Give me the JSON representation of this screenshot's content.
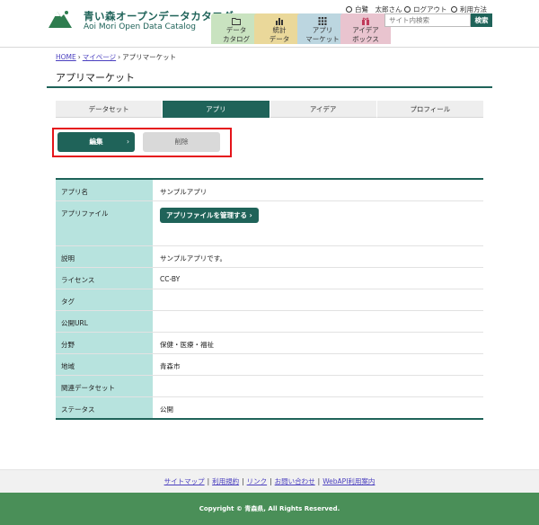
{
  "site": {
    "title": "青い森オープンデータカタログ",
    "subtitle": "Aoi Mori Open Data Catalog"
  },
  "nav": [
    {
      "line1": "データ",
      "line2": "カタログ",
      "icon": "folder-icon",
      "color": "#c9e3c0"
    },
    {
      "line1": "統計",
      "line2": "データ",
      "icon": "bar-chart-icon",
      "color": "#ead89a"
    },
    {
      "line1": "アプリ",
      "line2": "マーケット",
      "icon": "grid-icon",
      "color": "#bcd6e0"
    },
    {
      "line1": "アイデア",
      "line2": "ボックス",
      "icon": "gift-icon",
      "color": "#e9c4cf"
    }
  ],
  "utility": {
    "user": "白鷺　太郎さん",
    "logout": "ログアウト",
    "help": "利用方法"
  },
  "search": {
    "placeholder": "サイト内検索",
    "button": "検索"
  },
  "breadcrumb": {
    "home": "HOME",
    "mypage": "マイページ",
    "current": "アプリマーケット",
    "separator": "›"
  },
  "page_title": "アプリマーケット",
  "tabs": [
    {
      "label": "データセット",
      "active": false
    },
    {
      "label": "アプリ",
      "active": true
    },
    {
      "label": "アイデア",
      "active": false
    },
    {
      "label": "プロフィール",
      "active": false
    }
  ],
  "actions": {
    "edit": "編集",
    "edit_chevron": "›",
    "delete": "削除"
  },
  "detail": {
    "app_name": {
      "label": "アプリ名",
      "value": "サンプルアプリ"
    },
    "app_file": {
      "label": "アプリファイル",
      "button": "アプリファイルを管理する ›"
    },
    "description": {
      "label": "説明",
      "value": "サンプルアプリです。"
    },
    "license": {
      "label": "ライセンス",
      "value": "CC-BY"
    },
    "tags": {
      "label": "タグ",
      "value": ""
    },
    "public_url": {
      "label": "公開URL",
      "value": ""
    },
    "field": {
      "label": "分野",
      "value": "保健・医療・福祉"
    },
    "area": {
      "label": "地域",
      "value": "青森市"
    },
    "related": {
      "label": "関連データセット",
      "value": ""
    },
    "status": {
      "label": "ステータス",
      "value": "公開"
    }
  },
  "footer": {
    "links": [
      "サイトマップ",
      "利用規約",
      "リンク",
      "お問い合わせ",
      "WebAPI利用案内"
    ],
    "separator": "|",
    "copyright": "Copyright © 青森県, All Rights Reserved."
  },
  "colors": {
    "primary": "#1f6359",
    "table_header": "#b7e3de",
    "highlight": "#e5141a",
    "footer": "#4a8f58"
  }
}
